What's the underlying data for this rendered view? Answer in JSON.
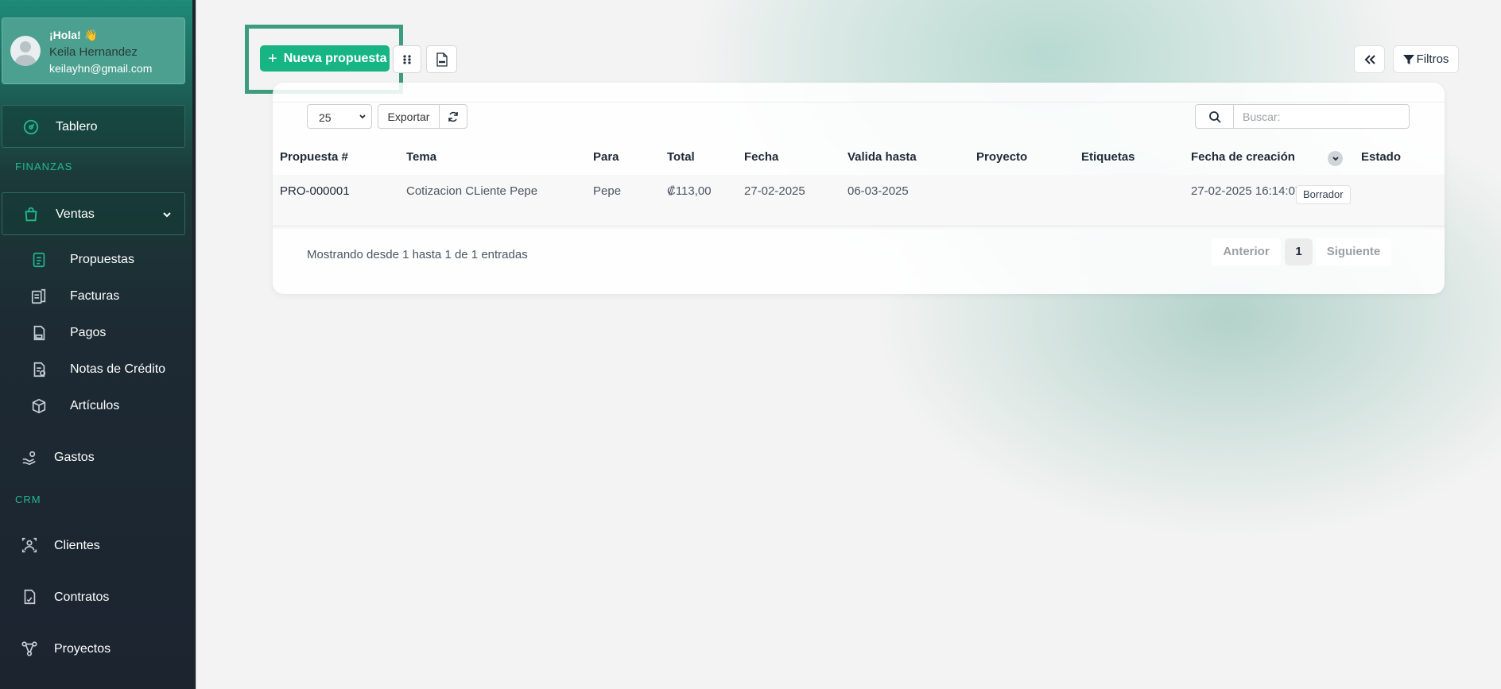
{
  "user": {
    "greeting": "¡Hola! 👋",
    "name": "Keila Hernandez",
    "email": "keilayhn@gmail.com"
  },
  "sidebar": {
    "dashboard": "Tablero",
    "finance_section": "FINANZAS",
    "sales": "Ventas",
    "sales_items": [
      "Propuestas",
      "Facturas",
      "Pagos",
      "Notas de Crédito",
      "Artículos"
    ],
    "expenses": "Gastos",
    "crm_section": "CRM",
    "crm_items": [
      "Clientes",
      "Contratos",
      "Proyectos"
    ]
  },
  "toolbar": {
    "new_proposal": "Nueva propuesta",
    "filters": "Filtros"
  },
  "table_controls": {
    "page_length": "25",
    "export": "Exportar",
    "search_placeholder": "Buscar:"
  },
  "table": {
    "columns": [
      "Propuesta #",
      "Tema",
      "Para",
      "Total",
      "Fecha",
      "Valida hasta",
      "Proyecto",
      "Etiquetas",
      "Fecha de creación",
      "Estado"
    ],
    "rows": [
      {
        "number": "PRO-000001",
        "subject": "Cotizacion CLiente Pepe",
        "to": "Pepe",
        "total": "₡113,00",
        "date": "27-02-2025",
        "valid_until": "06-03-2025",
        "project": "",
        "tags": "",
        "created": "27-02-2025 16:14:07",
        "status": "Borrador"
      }
    ]
  },
  "footer": {
    "info": "Mostrando desde 1 hasta 1 de 1 entradas",
    "prev": "Anterior",
    "page": "1",
    "next": "Siguiente"
  },
  "colors": {
    "accent": "#17b583",
    "highlight_border": "#3d9b7f",
    "sidebar_bg": "#1c2430"
  }
}
